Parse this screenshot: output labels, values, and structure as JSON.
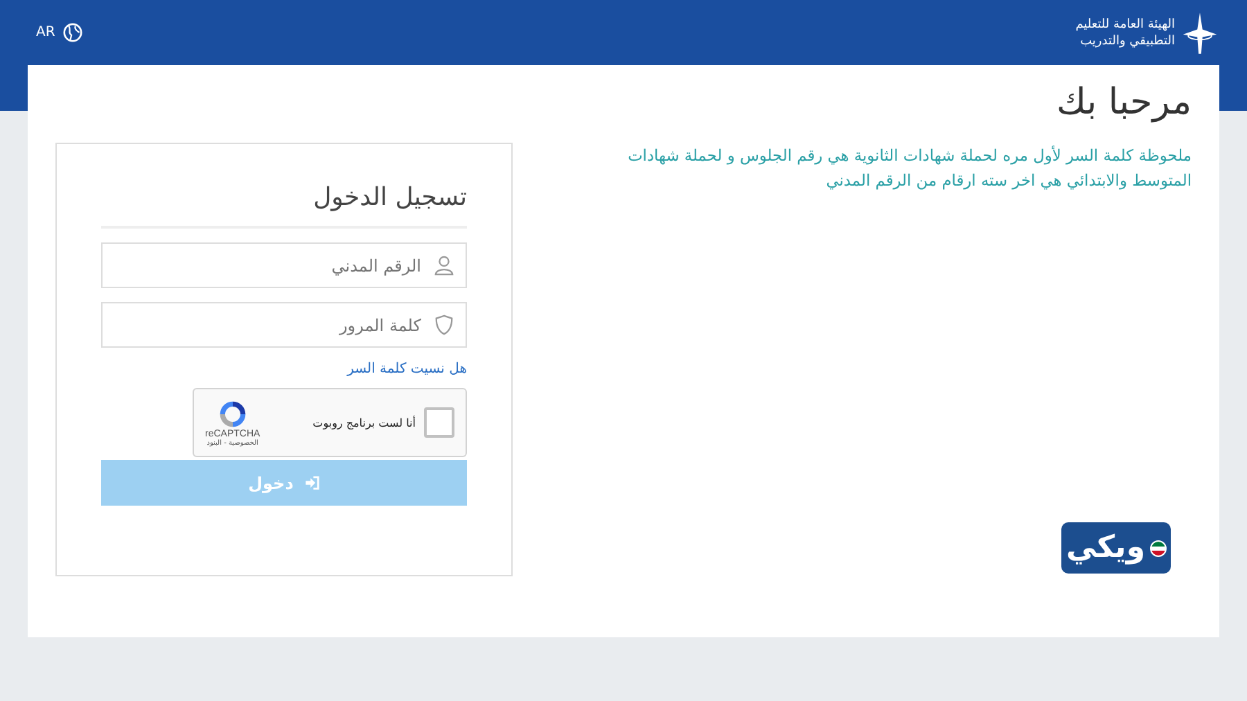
{
  "header": {
    "org_name_line1": "الهيئة العامة للتعليم",
    "org_name_line2": "التطبيقي والتدريب",
    "language": "AR"
  },
  "page_title": "مرحبا بك",
  "note": "ملحوظة كلمة السر لأول مره لحملة شهادات الثانوية هي رقم الجلوس و لحملة شهادات المتوسط والابتدائي هي اخر سته ارقام من الرقم المدني",
  "login": {
    "title": "تسجيل الدخول",
    "fields": [
      {
        "kind": "user",
        "placeholder": "الرقم المدني"
      },
      {
        "kind": "password",
        "placeholder": "كلمة المرور"
      }
    ],
    "forgot_link": "هل نسيت كلمة السر",
    "captcha": {
      "label": "أنا لست برنامج روبوت",
      "checked": false,
      "brand": "reCAPTCHA",
      "terms": "الخصوصية - البنود"
    },
    "submit": {
      "label": "دخول",
      "disabled": true
    }
  },
  "wiki_logo": "ويكي"
}
